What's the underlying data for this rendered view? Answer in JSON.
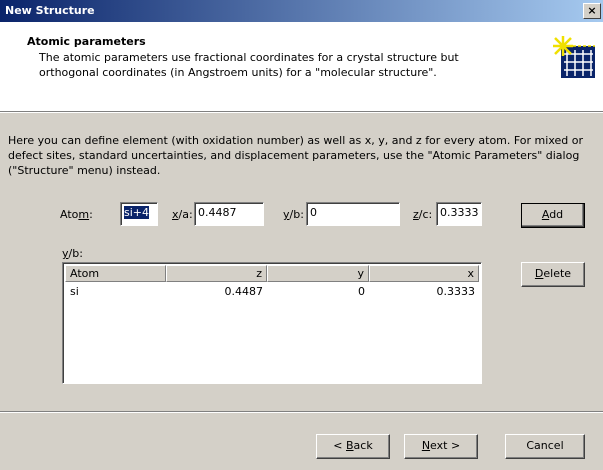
{
  "window": {
    "title": "New Structure",
    "close_glyph": "×"
  },
  "header": {
    "title": "Atomic parameters",
    "description": "The atomic parameters use fractional coordinates for a crystal structure but orthogonal coordinates (in Angstroem units) for a \"molecular structure\".",
    "icon": "crystal-grid-icon"
  },
  "intro_text": "Here you can define element (with oxidation number) as well as x, y, and z for every atom. For mixed or defect sites, standard uncertainties, and displacement parameters, use the \"Atomic Parameters\" dialog (\"Structure\" menu) instead.",
  "form": {
    "atom_label_pre": "Ato",
    "atom_label_u": "m",
    "atom_label_post": ":",
    "atom_value": "si+4",
    "x_label_u": "x",
    "x_label_post": "/a:",
    "x_value": "0.4487",
    "y_label_u": "y",
    "y_label_post": "/b:",
    "y_value": "0",
    "z_label_u": "z",
    "z_label_post": "/c:",
    "z_value": "0.3333",
    "add_label_u": "A",
    "add_label_post": "dd"
  },
  "list": {
    "caption_u": "y",
    "caption_post": "/b:",
    "columns": [
      "Atom",
      "z",
      "y",
      "x"
    ],
    "rows": [
      {
        "atom": "si",
        "z": "0.4487",
        "y": "0",
        "x": "0.3333"
      }
    ],
    "delete_label_u": "D",
    "delete_label_post": "elete"
  },
  "footer": {
    "back_pre": "< ",
    "back_u": "B",
    "back_post": "ack",
    "next_u": "N",
    "next_post": "ext >",
    "cancel": "Cancel"
  }
}
